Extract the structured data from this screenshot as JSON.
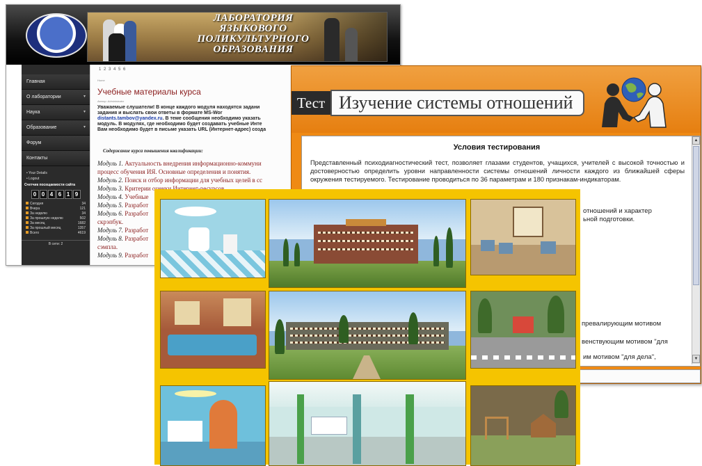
{
  "site": {
    "header_title": [
      "ЛАБОРАТОРИЯ",
      "ЯЗЫКОВОГО",
      "ПОЛИКУЛЬТУРНОГО",
      "ОБРАЗОВАНИЯ"
    ],
    "pager": "1 2 3 4 5 6",
    "breadcrumb": "Home",
    "menu": [
      {
        "label": "Главная",
        "arrow": ""
      },
      {
        "label": "О лаборатории",
        "arrow": "▾"
      },
      {
        "label": "Наука",
        "arrow": "▾"
      },
      {
        "label": "Образование",
        "arrow": "▾"
      },
      {
        "label": "Форум",
        "arrow": ""
      },
      {
        "label": "Контакты",
        "arrow": ""
      }
    ],
    "links": [
      "• Your Details",
      "• Logout"
    ],
    "counter_title": "Счетчик посещаемости сайта",
    "counter_digits": [
      "0",
      "0",
      "4",
      "6",
      "1",
      "9"
    ],
    "stats": [
      {
        "label": "Сегодня",
        "value": "34"
      },
      {
        "label": "Вчера",
        "value": "121"
      },
      {
        "label": "За неделю",
        "value": "34"
      },
      {
        "label": "За прошлую неделю",
        "value": "502"
      },
      {
        "label": "За месяц",
        "value": "1682"
      },
      {
        "label": "За прошлый месяц",
        "value": "1357"
      },
      {
        "label": "Всего",
        "value": "4619"
      }
    ],
    "online": "В сети: 2",
    "page_title": "Учебные материалы курса",
    "author": "Автор: Administrator",
    "intro_lines": [
      "Уважаемые слушатели! В конце каждого модуля находятся задани",
      "задания и выслать свои ответы в формате MS-Wor",
      "",
      "модуль. В модулях, где необходимо будет создавать учебные Инте",
      "Вам необходимо будет в письме указать URL (Интернет-адрес) созда"
    ],
    "intro_email": "distants.tambov@yandex.ru",
    "intro_email_tail": ". В теме сообщения необходимо указать",
    "course_head": "Содержание курса повышения квалификации:",
    "modules": [
      {
        "name": "Модуль 1.",
        "text": " Актуальность внедрения информационно-коммуни"
      },
      {
        "name": "",
        "text": "процесс обучения ИЯ. Основные определения и понятия."
      },
      {
        "name": "Модуль 2.",
        "text": " Поиск и отбор информации для учебных целей в сс"
      },
      {
        "name": "Модуль 3.",
        "text": " Критерии оценки Интернет-ресурсов."
      },
      {
        "name": "Модуль 4.",
        "text": " Учебные"
      },
      {
        "name": "Модуль 5.",
        "text": " Разработ"
      },
      {
        "name": "Модуль 6.",
        "text": " Разработ"
      },
      {
        "name": "",
        "text": "скрэпбук."
      },
      {
        "name": "Модуль 7.",
        "text": " Разработ"
      },
      {
        "name": "Модуль 8.",
        "text": "  Разработ"
      },
      {
        "name": "",
        "text": "сэмпла."
      },
      {
        "name": "Модуль 9.",
        "text": " Разработ"
      }
    ]
  },
  "test": {
    "tag": "Тест",
    "heading": "Изучение системы отношений",
    "panel_title": "Условия тестирования",
    "paragraph": "Представленный психодиагностический тест, позволяет глазами студентов, учащихся, учителей с высокой точностью и достоверностью определить уровни направленности системы отношений личности каждого из ближайшей сферы окружения тестируемого. Тестирование проводиться по 36 параметрам и 180 признакам-индикаторам.",
    "fragments": [
      "отношений  и  характер",
      "ьной подготовки.",
      "превалирующим мотивом",
      "венствующим мотивом \"для",
      "им мотивом \"для дела\","
    ],
    "scroll_up": "▲",
    "scroll_down": "▼"
  },
  "collage": {
    "background": "#f5c400",
    "tiles": [
      {
        "name": "tile-dental-room",
        "kind": "interior",
        "bg": "#9fd6e6",
        "accent": "#ffffff"
      },
      {
        "name": "tile-building-front",
        "kind": "building",
        "bg": "#8fb7dc",
        "accent": "#8a4b35"
      },
      {
        "name": "tile-classroom",
        "kind": "interior",
        "bg": "#d8c29a",
        "accent": "#7a5b3a"
      },
      {
        "name": "tile-pool-hall",
        "kind": "interior",
        "bg": "#a65a3a",
        "accent": "#4aa0c8"
      },
      {
        "name": "tile-building-wide",
        "kind": "building",
        "bg": "#8fb7dc",
        "accent": "#6a6a5a"
      },
      {
        "name": "tile-playground-street",
        "kind": "outdoor",
        "bg": "#6f8f5a",
        "accent": "#c0c0c0"
      },
      {
        "name": "tile-reception",
        "kind": "interior",
        "bg": "#6ec0dc",
        "accent": "#e07a3a"
      },
      {
        "name": "tile-atrium",
        "kind": "interior",
        "bg": "#cfe8e6",
        "accent": "#4aa04a"
      },
      {
        "name": "tile-playground",
        "kind": "outdoor",
        "bg": "#7a6a4a",
        "accent": "#c08a4a"
      }
    ]
  }
}
